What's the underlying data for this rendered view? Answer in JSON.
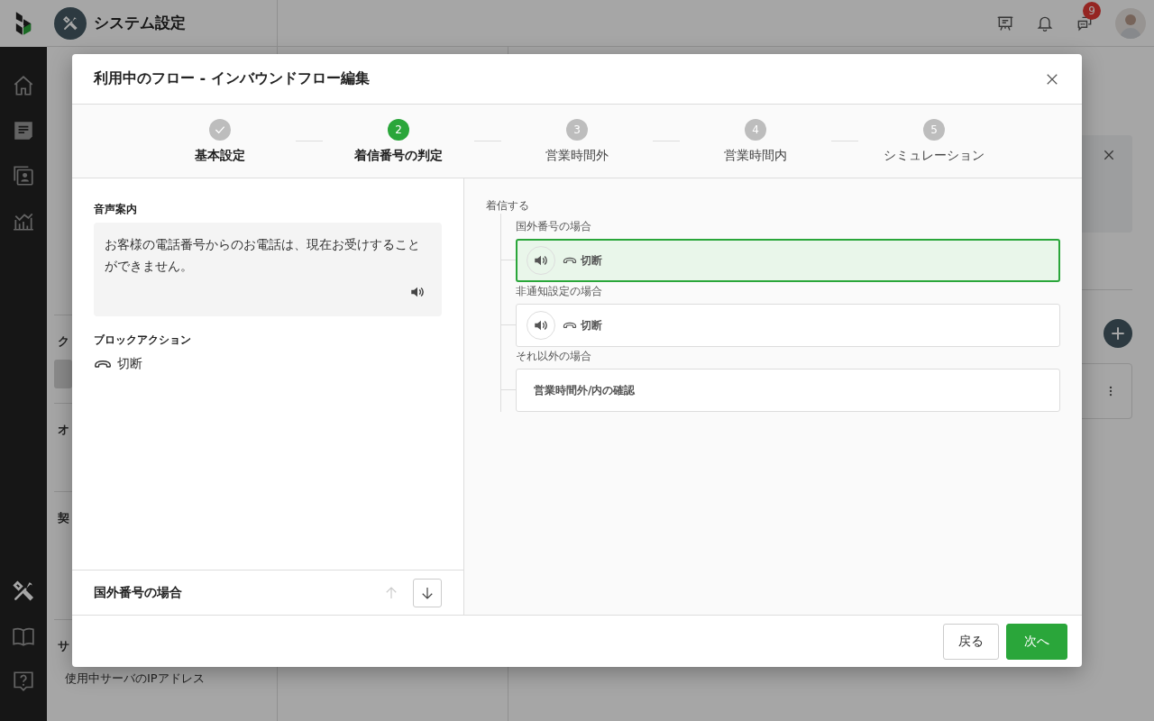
{
  "nav_rail": {
    "top": [
      {
        "kind": "home",
        "selected": false
      },
      {
        "kind": "list",
        "selected": false
      },
      {
        "kind": "contacts",
        "selected": false
      },
      {
        "kind": "chart",
        "selected": false
      }
    ],
    "bottom": [
      {
        "kind": "tools",
        "selected": true
      },
      {
        "kind": "book",
        "selected": false
      },
      {
        "kind": "help",
        "selected": false
      }
    ]
  },
  "app_header": {
    "title": "システム設定",
    "chat_badge": "9"
  },
  "settings_menu": [
    {
      "kind": "item",
      "selected": false
    },
    {
      "kind": "item",
      "selected": false
    },
    {
      "kind": "item",
      "selected": false
    },
    {
      "kind": "item",
      "selected": false
    },
    {
      "kind": "item",
      "selected": false
    },
    {
      "kind": "item",
      "selected": false
    },
    {
      "kind": "heading",
      "label": "ク"
    },
    {
      "kind": "item",
      "selected": true
    },
    {
      "kind": "heading",
      "label": "オ"
    },
    {
      "kind": "item",
      "selected": false
    },
    {
      "kind": "heading",
      "label": "契"
    },
    {
      "kind": "item",
      "selected": false
    },
    {
      "kind": "item",
      "selected": false
    },
    {
      "kind": "heading",
      "label": "サ"
    },
    {
      "kind": "item",
      "label": "使用中サーバのIPアドレス",
      "selected": false
    }
  ],
  "modal": {
    "title": "利用中のフロー - インバウンドフロー編集",
    "steps": [
      {
        "label": "基本設定",
        "completed": true,
        "selected": false
      },
      {
        "number": "2",
        "label": "着信番号の判定",
        "completed": false,
        "selected": true
      },
      {
        "number": "3",
        "label": "営業時間外",
        "completed": false,
        "selected": false
      },
      {
        "number": "4",
        "label": "営業時間内",
        "completed": false,
        "selected": false
      },
      {
        "number": "5",
        "label": "シミュレーション",
        "completed": false,
        "selected": false
      }
    ],
    "detail": {
      "voice_label": "音声案内",
      "voice_text": "お客様の電話番号からのお電話は、現在お受けすることができません。",
      "block_action_label": "ブロックアクション",
      "block_action": "切断"
    },
    "detail_footer": {
      "title": "国外番号の場合",
      "move_up": {
        "disabled": true
      },
      "move_down": {
        "disabled": false
      }
    },
    "flow": {
      "root": "着信する",
      "branches": [
        {
          "label": "国外番号の場合",
          "kind": "action",
          "selected": true,
          "action": "切断"
        },
        {
          "label": "非通知設定の場合",
          "kind": "action",
          "selected": false,
          "action": "切断"
        },
        {
          "label": "それ以外の場合",
          "kind": "next",
          "selected": false,
          "text": "営業時間外/内の確認"
        }
      ]
    },
    "buttons": {
      "back": "戻る",
      "next": "次へ"
    }
  }
}
